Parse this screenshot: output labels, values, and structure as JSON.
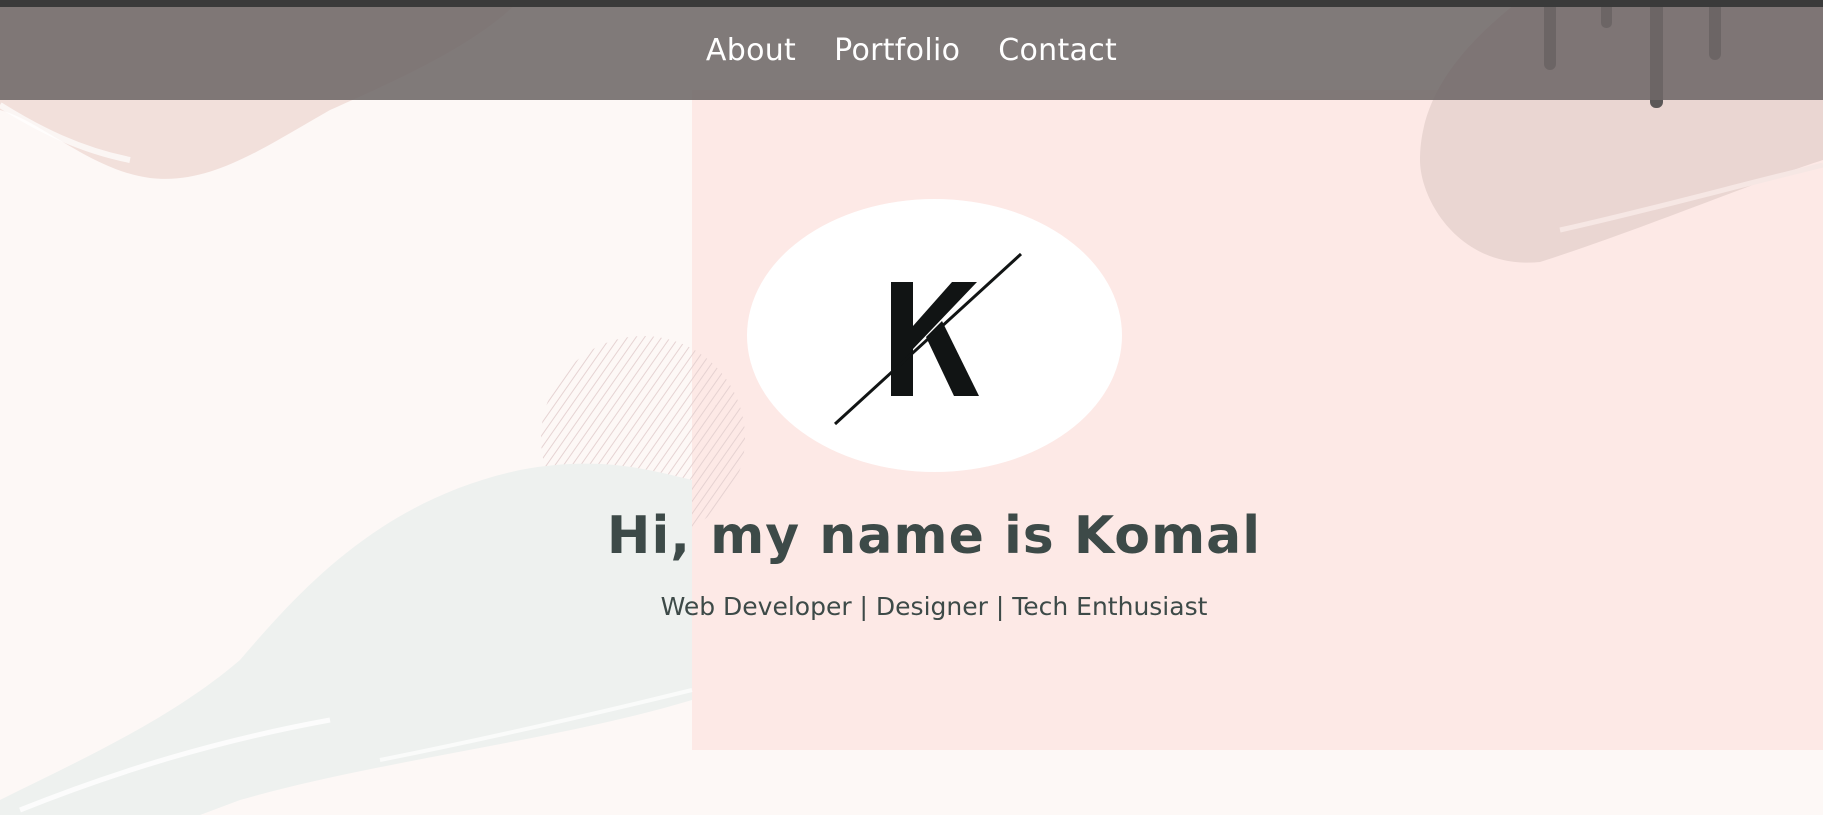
{
  "nav": {
    "items": [
      {
        "label": "About"
      },
      {
        "label": "Portfolio"
      },
      {
        "label": "Contact"
      }
    ]
  },
  "hero": {
    "logo_icon": "k-monogram-logo",
    "title": "Hi, my name is Komal",
    "subtitle": "Web Developer | Designer | Tech Enthusiast"
  },
  "colors": {
    "navbar_bg": "#6e6868",
    "text_dark": "#3d4a48",
    "nav_text": "#ffffff",
    "page_bg": "#fdf8f6",
    "pink_panel": "#fde9e6"
  }
}
